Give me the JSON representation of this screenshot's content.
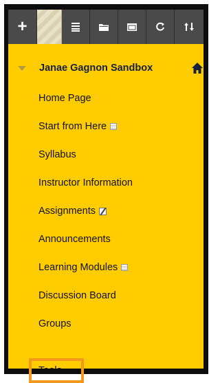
{
  "toolbar": {
    "buttons": [
      {
        "name": "add-icon",
        "glyph": "+"
      },
      {
        "name": "reorder-grip",
        "glyph": ""
      },
      {
        "name": "list-icon",
        "glyph": "list"
      },
      {
        "name": "folder-icon",
        "glyph": "folder"
      },
      {
        "name": "window-icon",
        "glyph": "window"
      },
      {
        "name": "refresh-icon",
        "glyph": "refresh"
      },
      {
        "name": "sort-icon",
        "glyph": "sort"
      }
    ]
  },
  "course": {
    "title": "Janae Gagnon Sandbox"
  },
  "menu": {
    "items": [
      {
        "label": "Home Page",
        "badge": ""
      },
      {
        "label": "Start from Here",
        "badge": "hidden-icon"
      },
      {
        "label": "Syllabus",
        "badge": ""
      },
      {
        "label": "Instructor Information",
        "badge": ""
      },
      {
        "label": "Assignments",
        "badge": "unavailable-icon"
      },
      {
        "label": "Announcements",
        "badge": ""
      },
      {
        "label": "Learning Modules",
        "badge": "hidden-icon"
      },
      {
        "label": "Discussion Board",
        "badge": ""
      },
      {
        "label": "Groups",
        "badge": ""
      },
      {
        "label": "Tools",
        "badge": ""
      }
    ]
  },
  "colors": {
    "menu_background": "#ffcc00",
    "toolbar_background": "#4a4a4a",
    "frame": "#0d0d0d",
    "highlight": "#f39a1e",
    "course_title": "#14203e"
  }
}
